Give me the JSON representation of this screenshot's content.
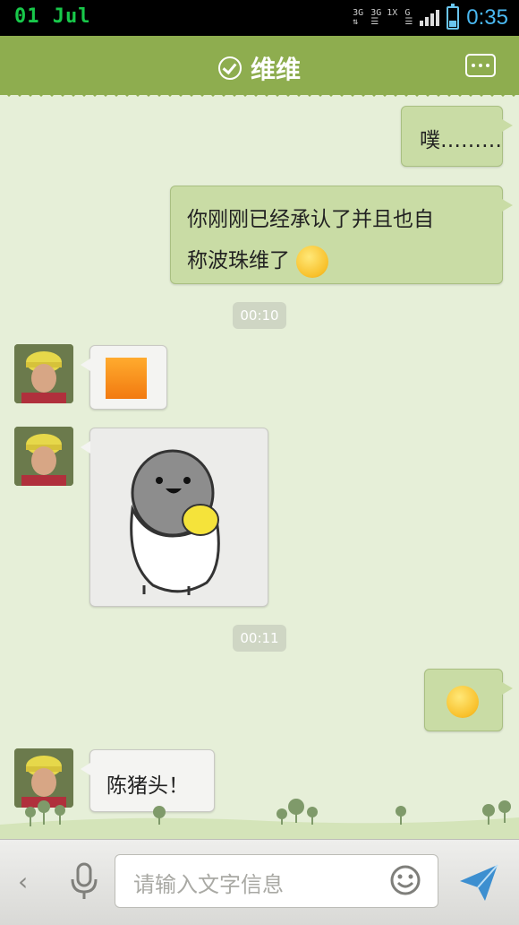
{
  "status_bar": {
    "date": "01 Jul",
    "network_labels": [
      "3G",
      "3G 1X",
      "G"
    ],
    "time": "0:35"
  },
  "header": {
    "title": "维维",
    "more_icon": "more-dots-icon",
    "status_icon": "check-circle-icon"
  },
  "messages": [
    {
      "side": "right",
      "type": "text",
      "text": "噗………"
    },
    {
      "side": "right",
      "type": "text",
      "text_line1": "你刚刚已经承认了并且也自",
      "text_line2": "称波珠维了",
      "emoji": "shy-emoji"
    },
    {
      "type": "time",
      "text": "00:10"
    },
    {
      "side": "left",
      "type": "image",
      "content": "orange-square"
    },
    {
      "side": "left",
      "type": "sticker",
      "content": "penguin-sticker"
    },
    {
      "type": "time",
      "text": "00:11"
    },
    {
      "side": "right",
      "type": "emoji",
      "content": "smile-emoji"
    },
    {
      "side": "left",
      "type": "text",
      "text": "陈猪头！"
    }
  ],
  "input_bar": {
    "placeholder": "请输入文字信息",
    "back_icon": "chevron-left-icon",
    "mic_icon": "microphone-icon",
    "emoji_icon": "smiley-icon",
    "send_icon": "send-icon"
  },
  "colors": {
    "header": "#8ead4f",
    "background": "#e6efd8",
    "bubble_right": "#c9dca5",
    "bubble_left": "#f4f4f2",
    "time_accent": "#4ab8f0",
    "date_accent": "#18c84a"
  }
}
